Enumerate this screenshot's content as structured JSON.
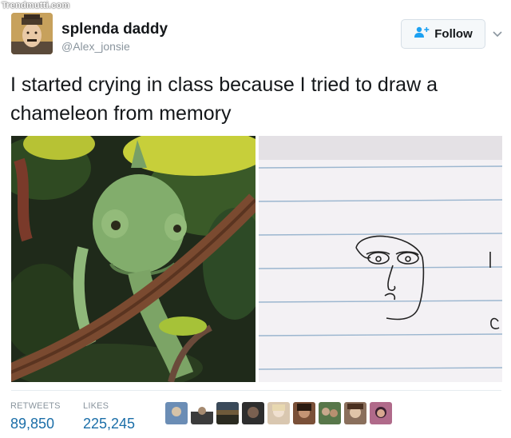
{
  "watermark": "Trendmutti.com",
  "user": {
    "display_name": "splenda daddy",
    "handle": "@Alex_jonsie"
  },
  "follow_button": {
    "label": "Follow"
  },
  "tweet": {
    "text": "I started crying in class because I tried to draw a chameleon from memory"
  },
  "stats": {
    "retweets_label": "RETWEETS",
    "retweets_value": "89,850",
    "likes_label": "LIKES",
    "likes_value": "225,245"
  },
  "liker_avatar_colors": [
    "#6b8db5",
    "#3b3b3b",
    "#6e5a3a",
    "#2e2e2e",
    "#d9c7b0",
    "#7a5038",
    "#58774a",
    "#8a6f5c",
    "#b06a8a"
  ],
  "colors": {
    "link_blue": "#1b6ea8",
    "muted_gray": "#8a959e",
    "text": "#14171a"
  }
}
